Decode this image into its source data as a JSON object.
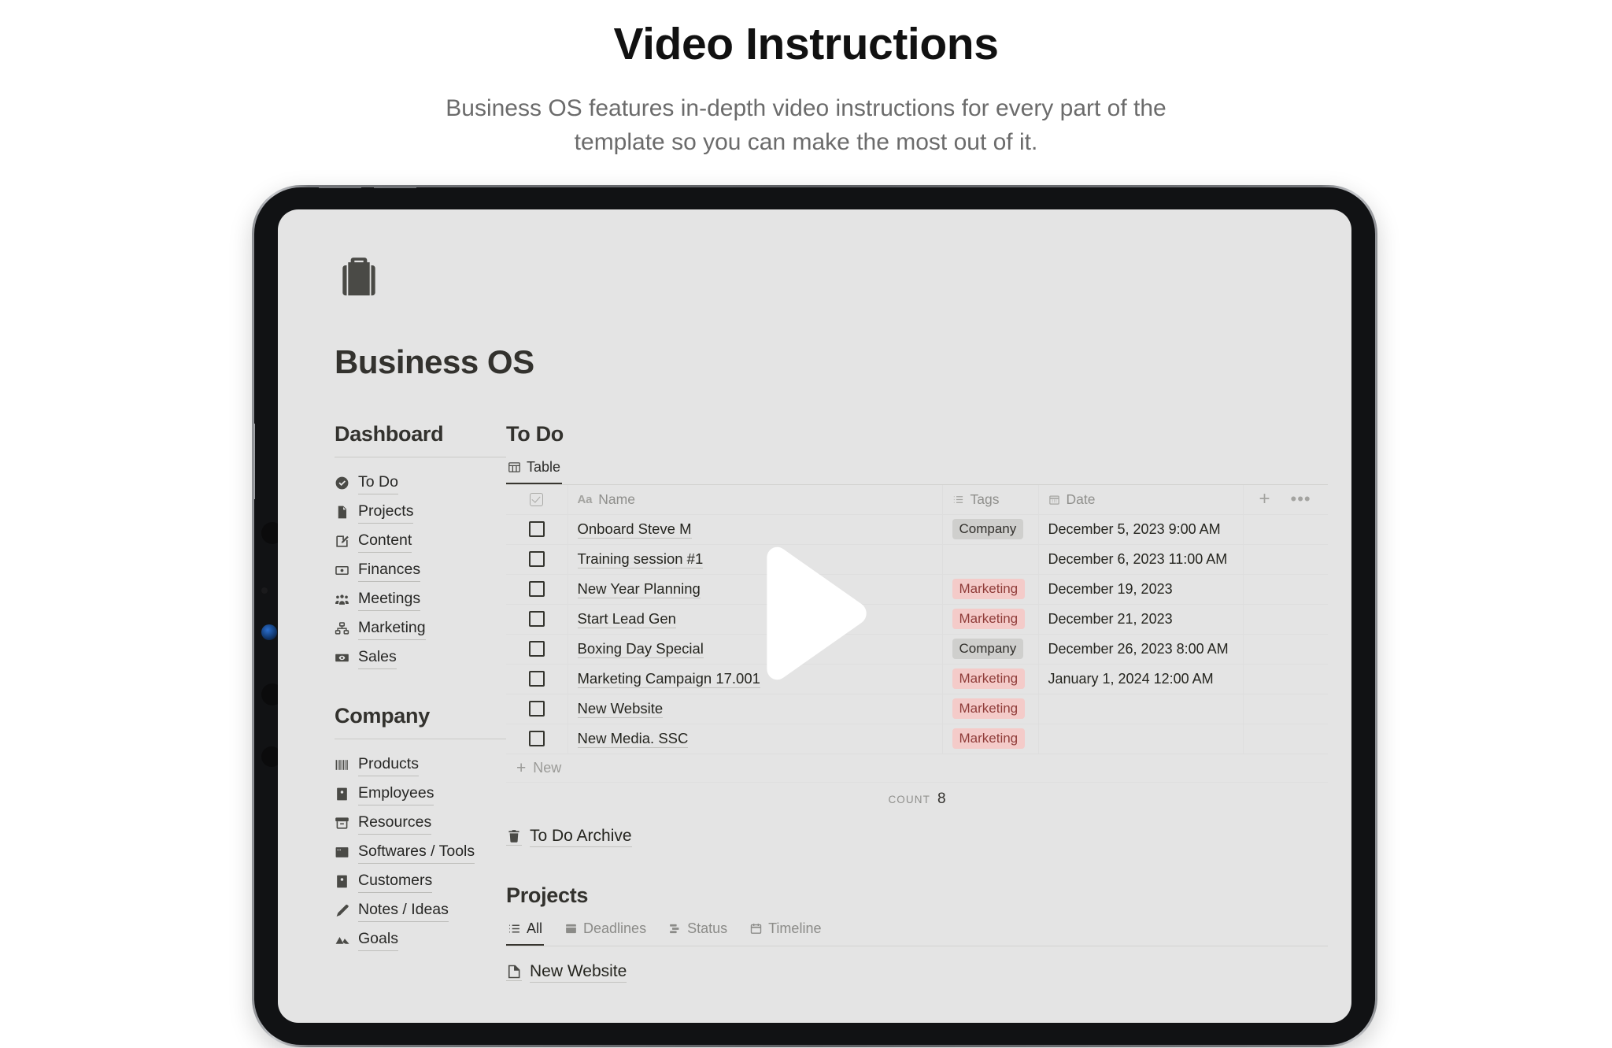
{
  "hero": {
    "title": "Video Instructions",
    "subtitle": "Business OS features in-depth video instructions for every part of the template so you can make the most out of it."
  },
  "device": {
    "type": "tablet",
    "hardware": [
      "volume-up-button",
      "volume-down-button",
      "power-button",
      "front-camera",
      "ambient-sensor",
      "lidar-sensor"
    ]
  },
  "app": {
    "logo_icon": "briefcase-icon",
    "workspace_title": "Business OS"
  },
  "sidebar": {
    "sections": [
      {
        "title": "Dashboard",
        "items": [
          {
            "label": "To Do",
            "icon": "check-circle-icon"
          },
          {
            "label": "Projects",
            "icon": "document-icon"
          },
          {
            "label": "Content",
            "icon": "pencil-square-icon"
          },
          {
            "label": "Finances",
            "icon": "banknote-icon"
          },
          {
            "label": "Meetings",
            "icon": "people-group-icon"
          },
          {
            "label": "Marketing",
            "icon": "org-chart-icon"
          },
          {
            "label": "Sales",
            "icon": "money-eye-icon"
          }
        ]
      },
      {
        "title": "Company",
        "items": [
          {
            "label": "Products",
            "icon": "barcode-icon"
          },
          {
            "label": "Employees",
            "icon": "id-badge-icon"
          },
          {
            "label": "Resources",
            "icon": "archive-box-icon"
          },
          {
            "label": "Softwares / Tools",
            "icon": "app-window-icon"
          },
          {
            "label": "Customers",
            "icon": "id-badge-icon"
          },
          {
            "label": "Notes / Ideas",
            "icon": "pencil-icon"
          },
          {
            "label": "Goals",
            "icon": "mountain-icon"
          }
        ]
      }
    ]
  },
  "todo": {
    "title": "To Do",
    "view_tabs": [
      {
        "label": "Table",
        "icon": "table-icon",
        "active": true
      }
    ],
    "columns": [
      {
        "key": "check",
        "label": "",
        "icon": "checkbox-icon"
      },
      {
        "key": "name",
        "label": "Name",
        "icon": "aa-text-icon"
      },
      {
        "key": "tags",
        "label": "Tags",
        "icon": "multi-select-icon"
      },
      {
        "key": "date",
        "label": "Date",
        "icon": "calendar-icon"
      }
    ],
    "tools": {
      "add": "+",
      "more": "•••"
    },
    "rows": [
      {
        "checked": false,
        "name": "Onboard Steve M",
        "tag": "Company",
        "date": "December 5, 2023 9:00 AM"
      },
      {
        "checked": false,
        "name": "Training session #1",
        "tag": "",
        "date": "December 6, 2023 11:00 AM"
      },
      {
        "checked": false,
        "name": "New Year Planning",
        "tag": "Marketing",
        "date": "December 19, 2023"
      },
      {
        "checked": false,
        "name": "Start Lead Gen",
        "tag": "Marketing",
        "date": "December 21, 2023"
      },
      {
        "checked": false,
        "name": "Boxing Day Special",
        "tag": "Company",
        "date": "December 26, 2023 8:00 AM"
      },
      {
        "checked": false,
        "name": "Marketing Campaign 17.001",
        "tag": "Marketing",
        "date": "January 1, 2024 12:00 AM"
      },
      {
        "checked": false,
        "name": "New Website",
        "tag": "Marketing",
        "date": ""
      },
      {
        "checked": false,
        "name": "New Media. SSC",
        "tag": "Marketing",
        "date": ""
      }
    ],
    "new_row_label": "New",
    "count_label": "COUNT",
    "count_value": "8",
    "archive_label": "To Do Archive",
    "archive_icon": "trash-icon"
  },
  "projects": {
    "title": "Projects",
    "view_tabs": [
      {
        "label": "All",
        "icon": "list-icon",
        "active": true
      },
      {
        "label": "Deadlines",
        "icon": "calendar-day-icon",
        "active": false
      },
      {
        "label": "Status",
        "icon": "board-icon",
        "active": false
      },
      {
        "label": "Timeline",
        "icon": "calendar-icon",
        "active": false
      }
    ],
    "rows": [
      {
        "name": "New Website",
        "icon": "page-icon"
      }
    ]
  },
  "player": {
    "play_icon": "play-triangle-icon"
  },
  "colors": {
    "page_background": "#ffffff",
    "screen_background": "#e4e4e4",
    "device_frame": "#111214",
    "tag_company_bg": "#cfcfcd",
    "tag_marketing_bg": "#f4cbc9",
    "tag_marketing_text": "#8f3b38",
    "text_primary": "#33322e",
    "text_muted": "#8f8f8c",
    "play_button": "#ffffff"
  }
}
